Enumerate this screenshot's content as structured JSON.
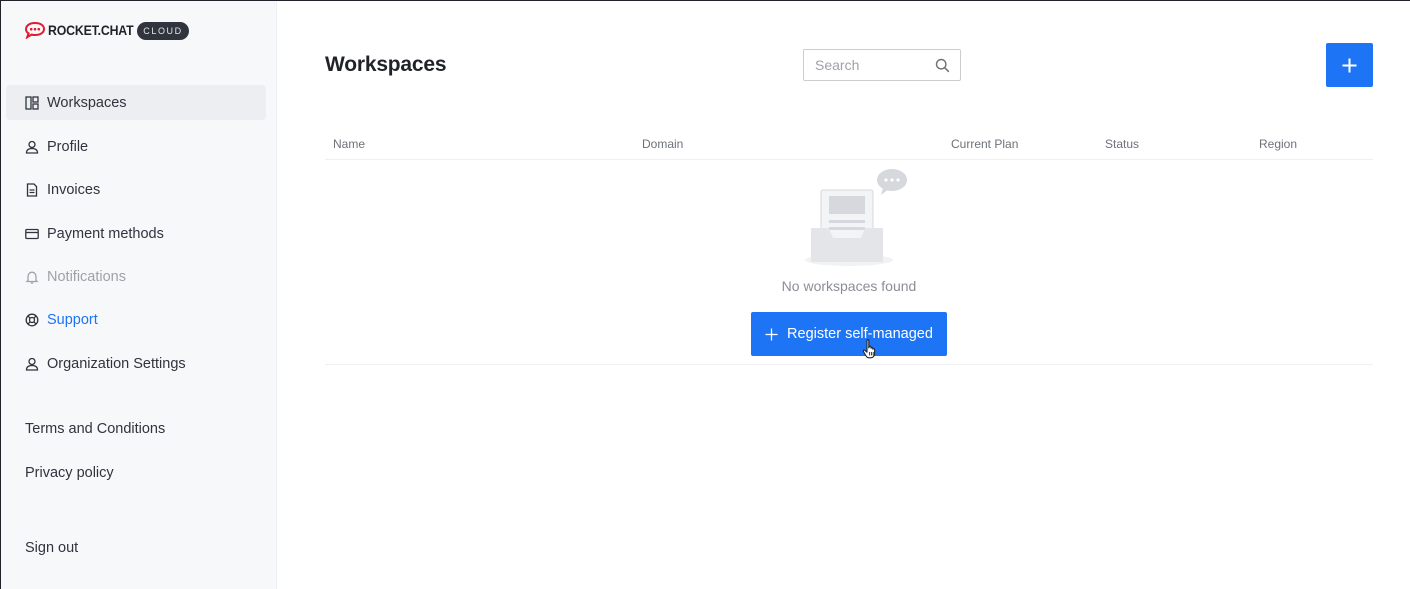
{
  "brand": {
    "name": "ROCKET.CHAT",
    "badge": "CLOUD",
    "accent_color": "#1d74f5",
    "logo_color": "#e01c2e"
  },
  "sidebar": {
    "items": [
      {
        "label": "Workspaces",
        "icon": "workspaces-icon",
        "state": "active"
      },
      {
        "label": "Profile",
        "icon": "user-icon",
        "state": "default"
      },
      {
        "label": "Invoices",
        "icon": "document-icon",
        "state": "default"
      },
      {
        "label": "Payment methods",
        "icon": "credit-card-icon",
        "state": "default"
      },
      {
        "label": "Notifications",
        "icon": "bell-icon",
        "state": "disabled"
      },
      {
        "label": "Support",
        "icon": "lifebuoy-icon",
        "state": "link"
      },
      {
        "label": "Organization Settings",
        "icon": "user-icon",
        "state": "default"
      }
    ],
    "footer": {
      "terms": "Terms and Conditions",
      "privacy": "Privacy policy",
      "sign_out": "Sign out"
    }
  },
  "main": {
    "title": "Workspaces",
    "search": {
      "placeholder": "Search",
      "value": ""
    },
    "add_button_icon": "plus-icon",
    "table": {
      "columns": [
        "Name",
        "Domain",
        "Current Plan",
        "Status",
        "Region"
      ],
      "rows": []
    },
    "empty_state": {
      "text": "No workspaces found",
      "button_label": "Register self-managed",
      "illustration": "empty-inbox-icon"
    }
  }
}
